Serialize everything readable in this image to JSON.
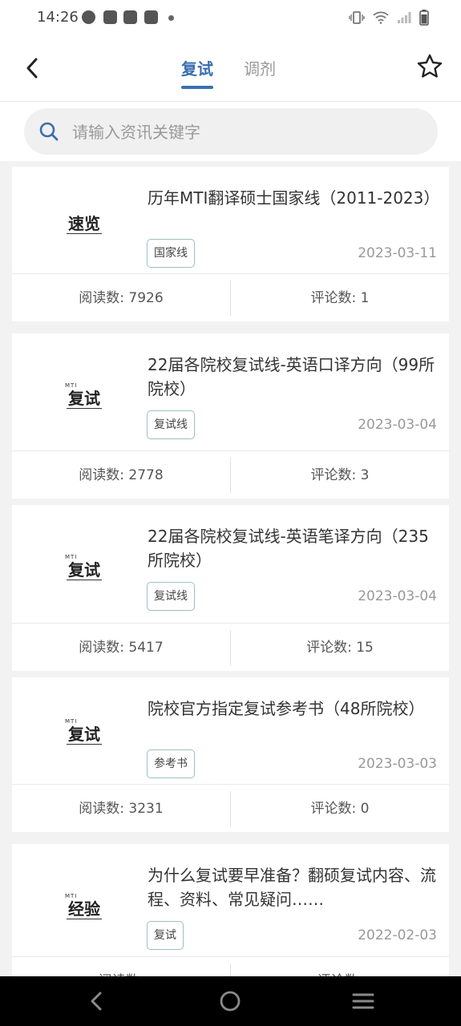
{
  "status_bar": {
    "time": "14:26"
  },
  "header": {
    "tabs": [
      {
        "label": "复试",
        "active": true
      },
      {
        "label": "调剂",
        "active": false
      }
    ]
  },
  "search": {
    "placeholder": "请输入资讯关键字",
    "value": ""
  },
  "articles": [
    {
      "thumb_text": "速览",
      "thumb_small": "",
      "title": "历年MTI翻译硕士国家线（2011-2023）",
      "tag": "国家线",
      "date": "2023-03-11",
      "reads": "阅读数: 7926",
      "comments": "评论数: 1"
    },
    {
      "thumb_text": "复试",
      "thumb_small": "MTI",
      "title": "22届各院校复试线-英语口译方向（99所院校）",
      "tag": "复试线",
      "date": "2023-03-04",
      "reads": "阅读数: 2778",
      "comments": "评论数: 3"
    },
    {
      "thumb_text": "复试",
      "thumb_small": "MTI",
      "title": "22届各院校复试线-英语笔译方向（235所院校）",
      "tag": "复试线",
      "date": "2023-03-04",
      "reads": "阅读数: 5417",
      "comments": "评论数: 15"
    },
    {
      "thumb_text": "复试",
      "thumb_small": "MTI",
      "title": "院校官方指定复试参考书（48所院校）",
      "tag": "参考书",
      "date": "2023-03-03",
      "reads": "阅读数: 3231",
      "comments": "评论数: 0"
    },
    {
      "thumb_text": "经验",
      "thumb_small": "MTI",
      "title": "为什么复试要早准备？翻硕复试内容、流程、资料、常见疑问……",
      "tag": "复试",
      "date": "2022-02-03",
      "reads": "阅读数: ",
      "comments": "评论数: "
    }
  ],
  "colors": {
    "accent": "#3a6fb0",
    "background": "#f2f2f2"
  }
}
